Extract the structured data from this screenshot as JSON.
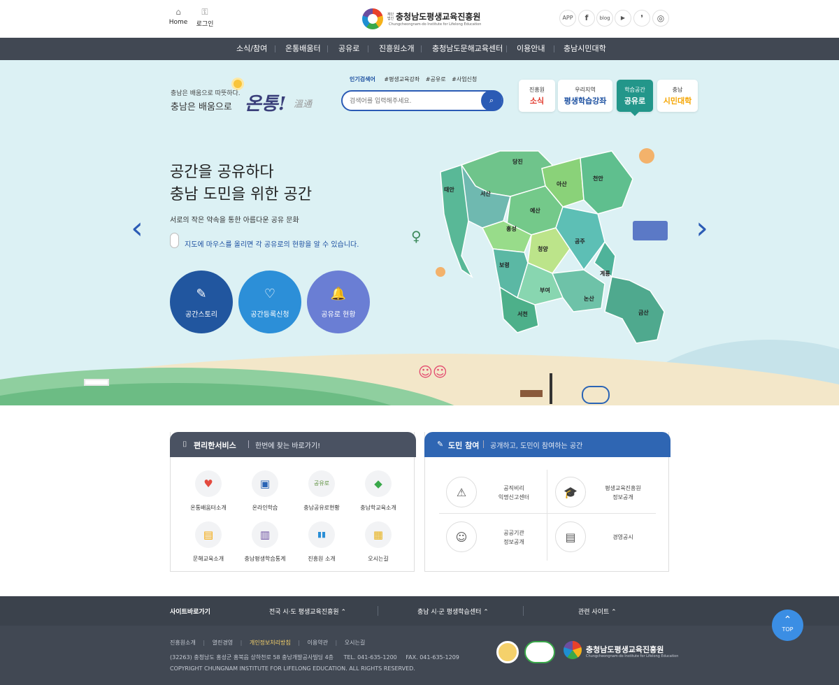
{
  "topbar": {
    "links": [
      {
        "label": "Home",
        "icon": "home-icon"
      },
      {
        "label": "로그인",
        "icon": "lock-icon"
      }
    ],
    "logo": {
      "small": "재단법인",
      "name": "충청남도평생교육진흥원",
      "en": "Chungcheongnam-do Institute for Lifelong Education"
    },
    "sns": [
      "APP",
      "f",
      "blog",
      "▶",
      "❜",
      "◎"
    ]
  },
  "gnb": [
    "소식/참여",
    "온통배움터",
    "공유로",
    "진흥원소개",
    "충청남도문해교육센터",
    "이용안내",
    "충남시민대학"
  ],
  "hero": {
    "slogan_small": "충남은 배움으로 따뜻하다.",
    "slogan_big": "충남은 배움으로",
    "slogan_call": "온통!",
    "slogan_hanja": "溫通",
    "keyword_title": "인기검색어",
    "keywords": [
      "#평생교육강좌",
      "#공유로",
      "#사업신청"
    ],
    "search_placeholder": "검색어를 입력해주세요.",
    "quick": [
      {
        "a": "진흥원",
        "b": "소식",
        "color": "#e23a2d",
        "active": false
      },
      {
        "a": "우리지역",
        "b": "평생학습강좌",
        "color": "#1b4fa0",
        "active": false
      },
      {
        "a": "학습공간",
        "b": "공유로",
        "color": "#fff",
        "active": true
      },
      {
        "a": "충남",
        "b": "시민대학",
        "color": "#f5a500",
        "active": false
      }
    ],
    "title1": "공간을 공유하다",
    "title2": "충남 도민을 위한 공간",
    "sub": "서로의 작은 약속을 통한 아름다운 공유 문화",
    "note": "지도에 마우스를 올리면 각 공유로의 현황을 알 수 있습니다.",
    "circles": [
      {
        "label": "공간스토리",
        "icon": "document-icon",
        "color": "#21569f"
      },
      {
        "label": "공간등록신청",
        "icon": "hands-heart-icon",
        "color": "#2c8fd8"
      },
      {
        "label": "공유로 현황",
        "icon": "bell-icon",
        "color": "#6a7ed4"
      }
    ],
    "map_regions": [
      "당진",
      "태안",
      "서산",
      "아산",
      "천안",
      "예산",
      "홍성",
      "청양",
      "공주",
      "보령",
      "계룡",
      "부여",
      "논산",
      "서천",
      "금산"
    ]
  },
  "services": {
    "title": "편리한서비스",
    "desc": "한번에 찾는 바로가기!",
    "items": [
      {
        "label": "온통배움터소개",
        "icon": "heart-hand-icon",
        "glyph": "♥"
      },
      {
        "label": "온라인학습",
        "icon": "monitor-icon",
        "glyph": "▣"
      },
      {
        "label": "충남공유로현황",
        "icon": "share-logo-icon",
        "glyph": "공유로"
      },
      {
        "label": "충남학교육소개",
        "icon": "map-icon",
        "glyph": "◆"
      },
      {
        "label": "문해교육소개",
        "icon": "book-icon",
        "glyph": "▤"
      },
      {
        "label": "충남평생학습통계",
        "icon": "chart-icon",
        "glyph": "▥"
      },
      {
        "label": "진흥원 소개",
        "icon": "people-icon",
        "glyph": "▮▮"
      },
      {
        "label": "오시는길",
        "icon": "bus-icon",
        "glyph": "▦"
      }
    ]
  },
  "citizen": {
    "title": "도민 참여",
    "desc": "공개하고, 도민이 참여하는 공간",
    "items": [
      {
        "l1": "공직비리",
        "l2": "익명신고센터",
        "icon": "siren-icon",
        "glyph": "⚠"
      },
      {
        "l1": "평생교육진흥원",
        "l2": "정보공개",
        "icon": "graduation-cap-icon",
        "glyph": "🎓"
      },
      {
        "l1": "공공기관",
        "l2": "정보공개",
        "icon": "users-icon",
        "glyph": "☺"
      },
      {
        "l1": "경영공시",
        "l2": "",
        "icon": "document-icon",
        "glyph": "▤"
      }
    ]
  },
  "footer": {
    "bar_title": "사이트바로가기",
    "bar_links": [
      "전국 시·도 평생교육진흥원",
      "충남 시·군 평생학습센터",
      "관련 사이트"
    ],
    "links": [
      "진흥원소개",
      "열린경영",
      "개인정보처리방침",
      "이용약관",
      "오시는길"
    ],
    "address": "(32263) 충청남도 홍성군 홍북읍 상하천로 58 충남개발공사빌딩 4층",
    "tel": "TEL. 041-635-1200",
    "fax": "FAX. 041-635-1209",
    "copyright": "COPYRIGHT CHUNGNAM INSTITUTE FOR LIFELONG EDUCATION. ALL RIGHTS RESERVED.",
    "top": "TOP"
  }
}
